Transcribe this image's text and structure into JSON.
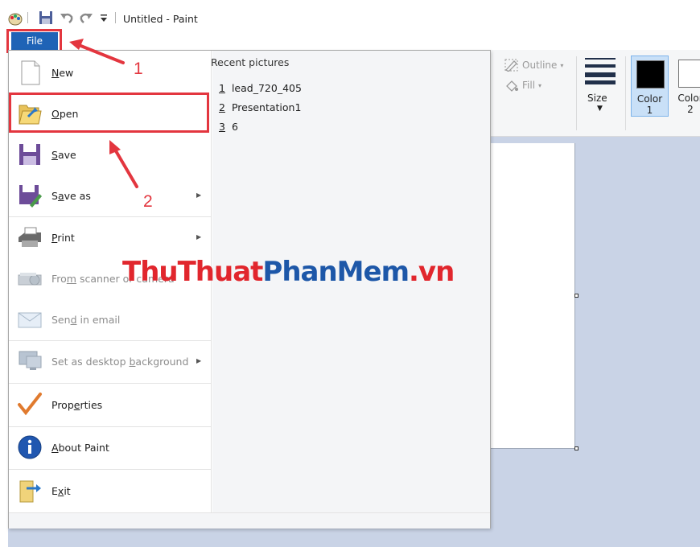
{
  "window": {
    "title": "Untitled - Paint"
  },
  "file_tab": {
    "label": "File"
  },
  "menu": {
    "items": [
      {
        "label": "New",
        "hotkey": "N",
        "enabled": true,
        "submenu": false,
        "icon": "new-document-icon"
      },
      {
        "label": "Open",
        "hotkey": "O",
        "enabled": true,
        "submenu": false,
        "icon": "open-folder-icon"
      },
      {
        "label": "Save",
        "hotkey": "S",
        "enabled": true,
        "submenu": false,
        "icon": "save-disk-icon"
      },
      {
        "label": "Save as",
        "hotkey": "a",
        "enabled": true,
        "submenu": true,
        "icon": "save-as-icon"
      },
      {
        "label": "Print",
        "hotkey": "P",
        "enabled": true,
        "submenu": true,
        "icon": "printer-icon"
      },
      {
        "label": "From scanner or camera",
        "hotkey": "m",
        "enabled": false,
        "submenu": false,
        "icon": "scanner-icon"
      },
      {
        "label": "Send in email",
        "hotkey": "d",
        "enabled": false,
        "submenu": false,
        "icon": "email-icon"
      },
      {
        "label": "Set as desktop background",
        "hotkey": "b",
        "enabled": false,
        "submenu": true,
        "icon": "desktop-icon"
      },
      {
        "label": "Properties",
        "hotkey": "e",
        "enabled": true,
        "submenu": false,
        "icon": "checkmark-icon"
      },
      {
        "label": "About Paint",
        "hotkey": "A",
        "enabled": true,
        "submenu": false,
        "icon": "info-icon"
      },
      {
        "label": "Exit",
        "hotkey": "x",
        "enabled": true,
        "submenu": false,
        "icon": "exit-icon"
      }
    ],
    "recent_title": "Recent pictures",
    "recent": [
      {
        "num": "1",
        "name": "lead_720_405"
      },
      {
        "num": "2",
        "name": "Presentation1"
      },
      {
        "num": "3",
        "name": "6"
      }
    ]
  },
  "ribbon": {
    "outline_label": "Outline",
    "fill_label": "Fill",
    "size_label": "Size",
    "color1_label": "Color",
    "color1_num": "1",
    "color2_label": "Color",
    "color2_num": "2",
    "color1_value": "#000000",
    "color2_value": "#ffffff"
  },
  "annotations": {
    "step1": "1",
    "step2": "2",
    "highlight_color": "#e3363f"
  },
  "watermark": {
    "part1": "ThuThuat",
    "part2": "PhanMem",
    "part3": ".vn"
  }
}
